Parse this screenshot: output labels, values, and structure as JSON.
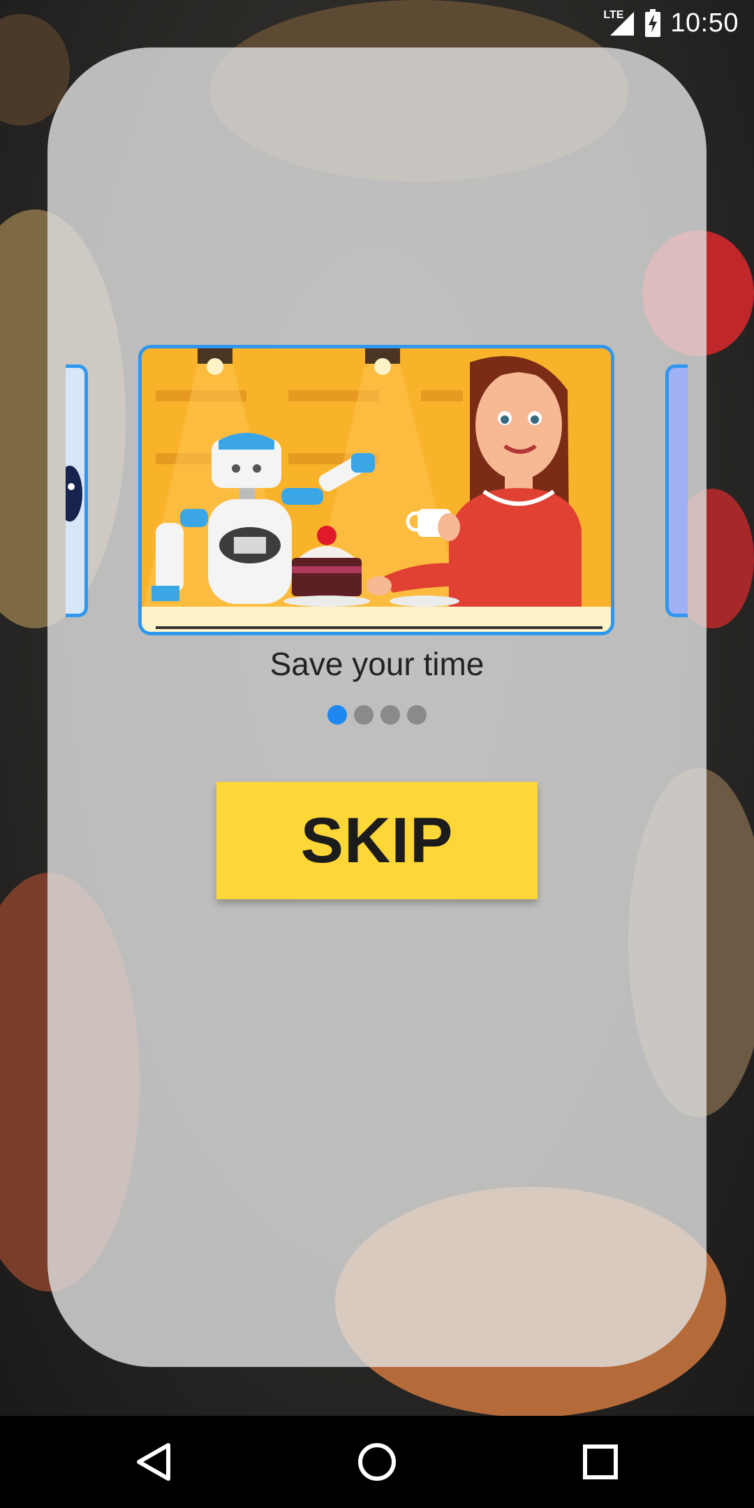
{
  "status_bar": {
    "time": "10:50",
    "network": "LTE"
  },
  "onboarding": {
    "caption": "Save your time",
    "page_count": 4,
    "active_page": 1,
    "skip_label": "SKIP"
  },
  "colors": {
    "accent_blue": "#2f97f0",
    "skip_yellow": "#fdd637",
    "slide_orange": "#f9b32a"
  },
  "icons": {
    "nav_back": "back-triangle-icon",
    "nav_home": "home-circle-icon",
    "nav_recents": "recents-square-icon"
  }
}
